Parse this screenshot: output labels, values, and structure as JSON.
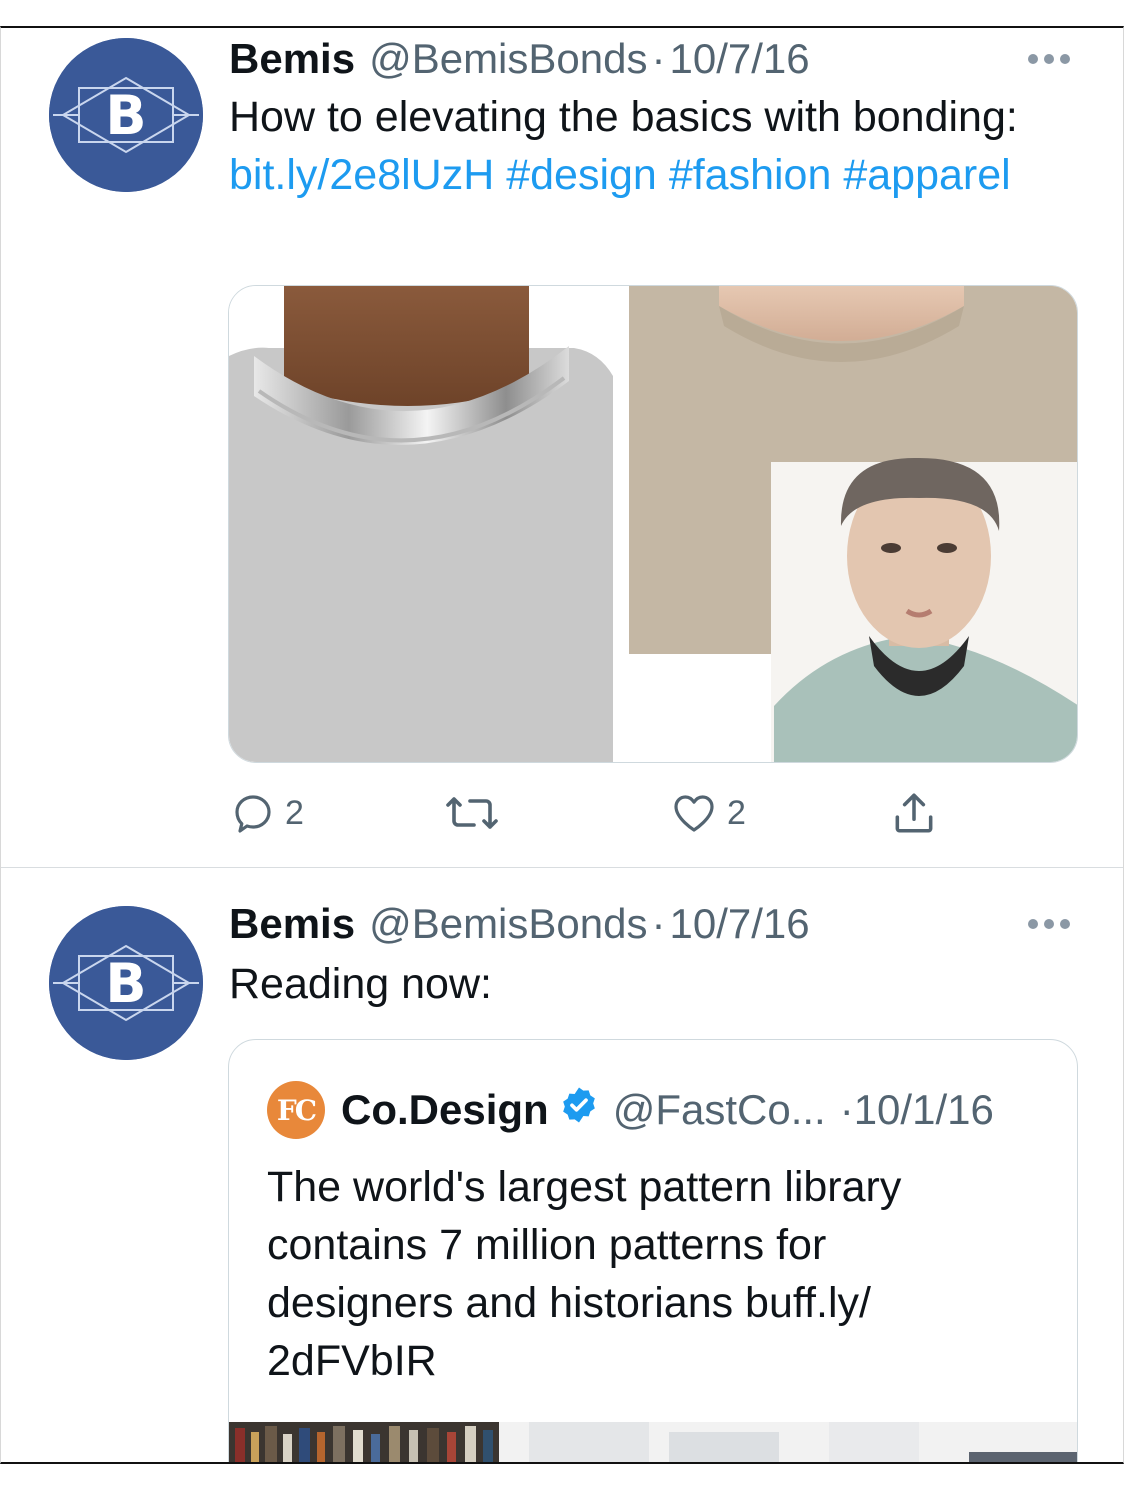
{
  "tweets": [
    {
      "author_name": "Bemis",
      "author_handle": "@BemisBonds",
      "separator": "·",
      "date": "10/7/16",
      "text_plain": "How to elevating the basics with bonding: ",
      "link": "bit.ly/2e8lUzH",
      "hashtags": [
        "#design",
        "#fashion",
        "#apparel"
      ],
      "actions": {
        "reply_count": "2",
        "retweet_count": "",
        "like_count": "2"
      },
      "media_images": [
        "silver-collar-sweatshirt",
        "beige-sweatshirt-neckline",
        "model-with-bonded-collar"
      ]
    },
    {
      "author_name": "Bemis",
      "author_handle": "@BemisBonds",
      "separator": "·",
      "date": "10/7/16",
      "text_plain": "Reading now:",
      "quote": {
        "logo_text": "FC",
        "name": "Co.Design",
        "handle": "@FastCo...",
        "separator": "·",
        "date": "10/1/16",
        "text": "The world's largest pattern library contains 7 million patterns for designers and historians buff.ly/ 2dFVbIR",
        "media_image": "library-shelves"
      }
    }
  ],
  "icons": {
    "avatar_letter": "B",
    "more": "more-horizontal-icon",
    "reply": "reply-icon",
    "retweet": "retweet-icon",
    "like": "heart-icon",
    "share": "share-icon",
    "verified": "verified-badge-icon"
  },
  "colors": {
    "link": "#1d9bf0",
    "secondary_text": "#536471",
    "avatar_bg": "#3a5998",
    "verified": "#1d9bf0",
    "fc_logo": "#e8883a"
  }
}
